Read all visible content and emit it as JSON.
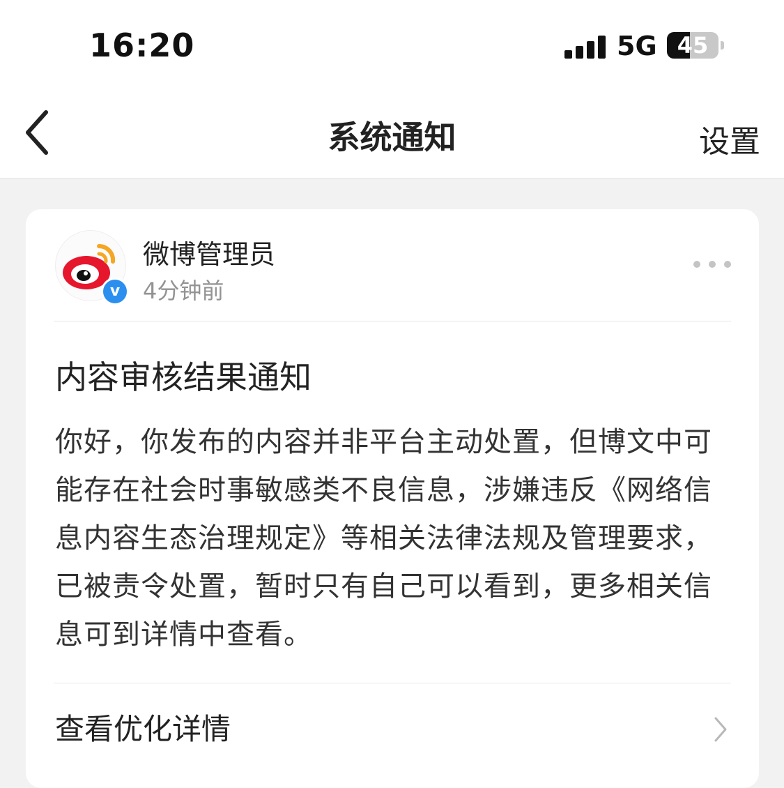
{
  "status_bar": {
    "time": "16:20",
    "network": "5G",
    "battery": "45",
    "battery_level": 0.45
  },
  "nav": {
    "title": "系统通知",
    "settings_label": "设置"
  },
  "message": {
    "author": "微博管理员",
    "time_ago": "4分钟前",
    "title": "内容审核结果通知",
    "body": "你好，你发布的内容并非平台主动处置，但博文中可能存在社会时事敏感类不良信息，涉嫌违反《网络信息内容生态治理规定》等相关法律法规及管理要求，已被责令处置，暂时只有自己可以看到，更多相关信息可到详情中查看。",
    "detail_link": "查看优化详情"
  },
  "colors": {
    "weibo_red": "#e6162d",
    "weibo_orange": "#f5a623",
    "verified_blue": "#2b8ff0"
  },
  "icons": [
    "back-chevron-icon",
    "signal-icon",
    "battery-icon",
    "weibo-logo-icon",
    "verified-icon",
    "more-icon",
    "chevron-right-icon"
  ]
}
